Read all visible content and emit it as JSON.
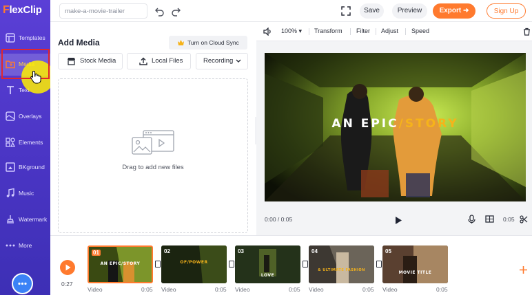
{
  "app": {
    "logo_f": "F",
    "logo_rest": "lexClip"
  },
  "sidebar": {
    "items": [
      {
        "label": "Templates",
        "icon": "templates-icon"
      },
      {
        "label": "Media",
        "icon": "media-icon"
      },
      {
        "label": "Text",
        "icon": "text-icon"
      },
      {
        "label": "Overlays",
        "icon": "overlays-icon"
      },
      {
        "label": "Elements",
        "icon": "elements-icon"
      },
      {
        "label": "BKground",
        "icon": "background-icon"
      },
      {
        "label": "Music",
        "icon": "music-icon"
      },
      {
        "label": "Watermark",
        "icon": "watermark-icon"
      },
      {
        "label": "More",
        "icon": "more-icon"
      }
    ],
    "active_index": 1
  },
  "topbar": {
    "project_name": "make-a-movie-trailer",
    "save": "Save",
    "preview": "Preview",
    "export": "Export",
    "signup": "Sign Up"
  },
  "media_panel": {
    "title": "Add Media",
    "cloud_sync": "Turn on Cloud Sync",
    "stock_media": "Stock Media",
    "local_files": "Local Files",
    "recording": "Recording",
    "drop_text": "Drag to add new files"
  },
  "preview": {
    "toolbar": {
      "zoom": "100%",
      "transform": "Transform",
      "filter": "Filter",
      "adjust": "Adjust",
      "speed": "Speed"
    },
    "title_part1": "AN EPIC",
    "title_slash": "/",
    "title_part2": "STORY",
    "current_time": "0:00 / 0:05",
    "duration": "0:05"
  },
  "timeline": {
    "total": "0:27",
    "clips": [
      {
        "num": "01",
        "title": "AN EPIC/STORY",
        "type": "Video",
        "duration": "0:05"
      },
      {
        "num": "02",
        "title": "OF/POWER",
        "type": "Video",
        "duration": "0:05"
      },
      {
        "num": "03",
        "title": "LOVE",
        "type": "Video",
        "duration": "0:05"
      },
      {
        "num": "04",
        "title": "& ULTIMATE FASHION",
        "type": "Video",
        "duration": "0:05"
      },
      {
        "num": "05",
        "title": "MOVIE TITLE",
        "type": "Video",
        "duration": "0:05"
      }
    ]
  },
  "colors": {
    "accent": "#ff7a2e",
    "sidebar": "#4a35c4",
    "highlight": "#e0262d"
  }
}
